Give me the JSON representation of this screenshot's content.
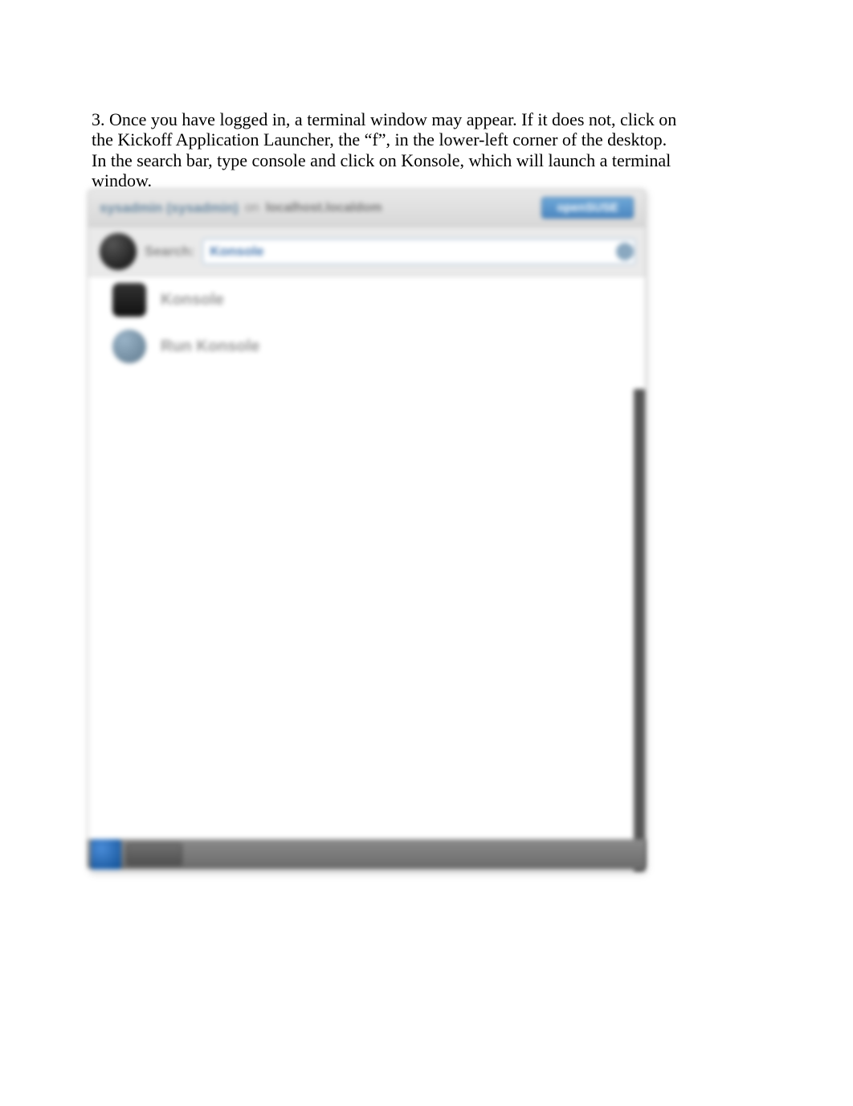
{
  "instruction": "3. Once you have logged in, a terminal window may appear. If it does not, click on the Kickoff Application Launcher, the “f”, in the lower-left corner of the desktop. In the search bar, type console and click on Konsole, which will launch a terminal window.",
  "launcher": {
    "header": {
      "user_text": "sysadmin (sysadmin)",
      "dash": "on",
      "host_text": "localhost.localdom",
      "button_label": "openSUSE"
    },
    "search": {
      "label": "Search:",
      "value": "Konsole"
    },
    "results": [
      {
        "label": "Konsole",
        "icon": "terminal"
      },
      {
        "label": "Run Konsole",
        "icon": "run"
      }
    ]
  }
}
